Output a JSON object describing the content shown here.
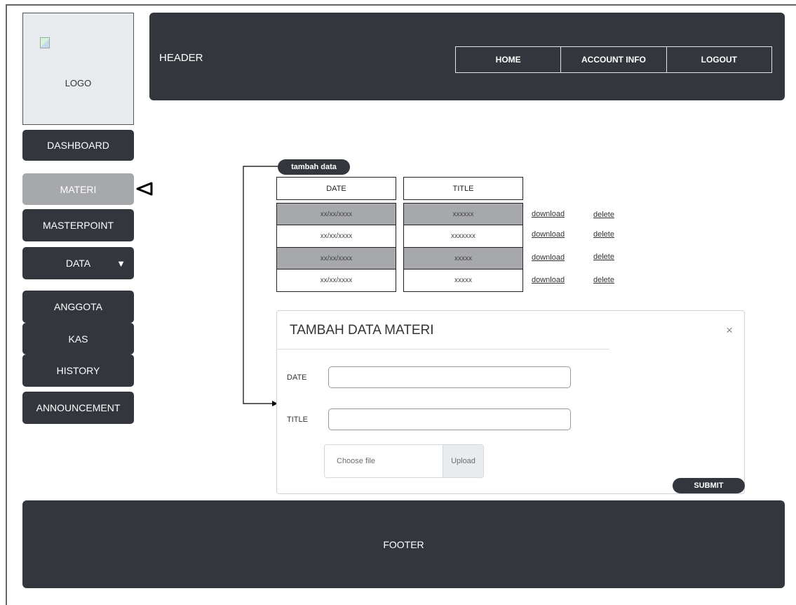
{
  "logo": {
    "label": "LOGO"
  },
  "header": {
    "title": "HEADER",
    "nav": [
      "HOME",
      "ACCOUNT INFO",
      "LOGOUT"
    ]
  },
  "sidebar": {
    "items": [
      {
        "label": "DASHBOARD"
      },
      {
        "label": "MATERI",
        "active": true
      },
      {
        "label": "MASTERPOINT"
      },
      {
        "label": "DATA",
        "dropdown": "▼"
      },
      {
        "label": "ANGGOTA"
      },
      {
        "label": "KAS"
      },
      {
        "label": "HISTORY"
      },
      {
        "label": "ANNOUNCEMENT"
      }
    ]
  },
  "table": {
    "add_button": "tambah data",
    "headers": [
      "DATE",
      "TITLE"
    ],
    "rows": [
      {
        "date": "xx/xx/xxxx",
        "title": "xxxxxx",
        "download": "download",
        "delete": "delete",
        "shaded": true
      },
      {
        "date": "xx/xx/xxxx",
        "title": "xxxxxxx",
        "download": "download",
        "delete": "delete",
        "shaded": false
      },
      {
        "date": "xx/xx/xxxx",
        "title": "xxxxx",
        "download": "download",
        "delete": "delete",
        "shaded": true
      },
      {
        "date": "xx/xx/xxxx",
        "title": "xxxxx",
        "download": "download",
        "delete": "delete",
        "shaded": false
      }
    ]
  },
  "modal": {
    "title": "TAMBAH DATA MATERI",
    "close": "×",
    "date_label": "DATE",
    "date_value": "",
    "title_label": "TITLE",
    "title_value": "",
    "file_placeholder": "Choose file",
    "upload_label": "Upload",
    "submit_label": "SUBMIT"
  },
  "footer": {
    "label": "FOOTER"
  },
  "colors": {
    "dark": "#33373d",
    "active": "#a6a8ab",
    "shaded_row": "#a6a8ab"
  }
}
